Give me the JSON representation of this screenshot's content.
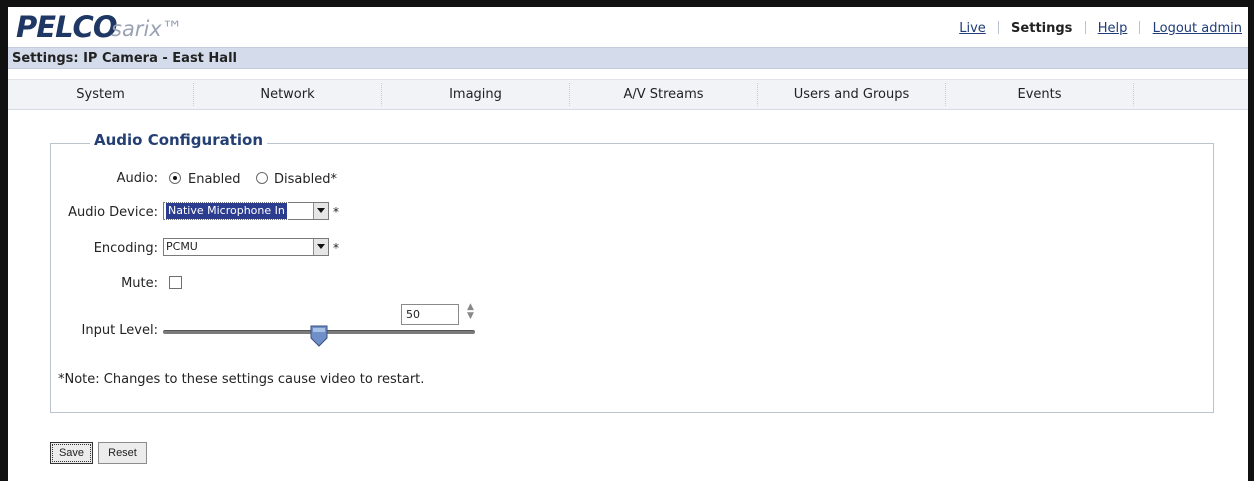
{
  "header": {
    "logo": "PELCO",
    "product": "sarix™",
    "links": [
      "Live",
      "Settings",
      "Help",
      "Logout admin"
    ],
    "active_link": "Settings"
  },
  "title": "Settings: IP Camera - East Hall",
  "tabs": [
    "System",
    "Network",
    "Imaging",
    "A/V Streams",
    "Users and Groups",
    "Events"
  ],
  "section": {
    "legend": "Audio Configuration",
    "audio": {
      "label": "Audio:",
      "options": [
        "Enabled",
        "Disabled*"
      ],
      "selected": "Enabled"
    },
    "audio_device": {
      "label": "Audio Device:",
      "value": "Native Microphone In",
      "required": "*"
    },
    "encoding": {
      "label": "Encoding:",
      "value": "PCMU",
      "required": "*"
    },
    "mute": {
      "label": "Mute:",
      "checked": false
    },
    "input_level": {
      "label": "Input Level:",
      "value": "50",
      "level_fraction": 0.5
    },
    "note": "*Note: Changes to these settings cause video to restart."
  },
  "buttons": {
    "save": "Save",
    "reset": "Reset"
  },
  "colors": {
    "logo": "#1f3764",
    "titlebar": "#d4dceb",
    "legend": "#233f73",
    "selection": "#2c3d8f",
    "slider_thumb": "#6f8fc9"
  }
}
